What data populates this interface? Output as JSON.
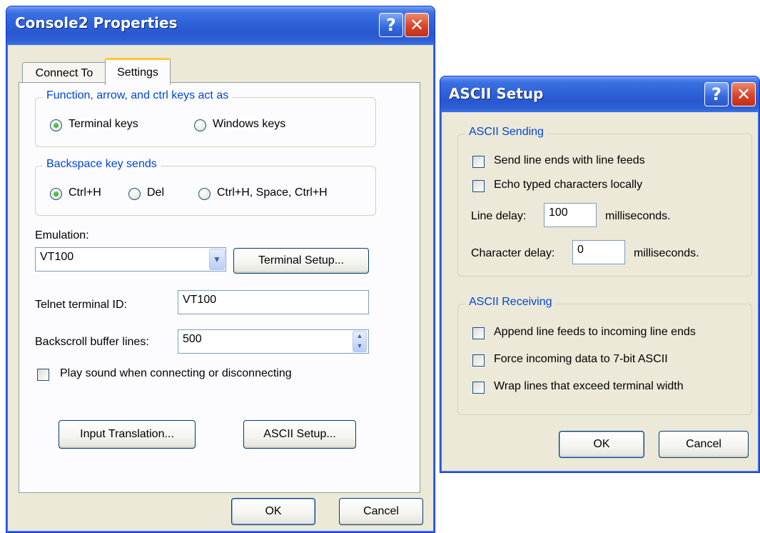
{
  "console_properties": {
    "title": "Console2 Properties",
    "help_glyph": "?",
    "close_glyph": "✕",
    "tabs": [
      {
        "label": "Connect To"
      },
      {
        "label": "Settings"
      }
    ],
    "function_keys": {
      "legend": "Function, arrow, and ctrl keys act as",
      "options": [
        {
          "label": "Terminal keys",
          "checked": true
        },
        {
          "label": "Windows keys",
          "checked": false
        }
      ]
    },
    "backspace": {
      "legend": "Backspace key sends",
      "options": [
        {
          "label": "Ctrl+H",
          "checked": true
        },
        {
          "label": "Del",
          "checked": false
        },
        {
          "label": "Ctrl+H, Space, Ctrl+H",
          "checked": false
        }
      ]
    },
    "emulation": {
      "label": "Emulation:",
      "value": "VT100",
      "terminal_setup_label": "Terminal Setup..."
    },
    "telnet": {
      "label": "Telnet terminal ID:",
      "value": "VT100"
    },
    "backscroll": {
      "label": "Backscroll buffer lines:",
      "value": "500"
    },
    "play_sound": {
      "label": "Play sound when connecting or disconnecting",
      "checked": false
    },
    "input_translation_label": "Input Translation...",
    "ascii_setup_label": "ASCII Setup...",
    "ok_label": "OK",
    "cancel_label": "Cancel"
  },
  "ascii_setup": {
    "title": "ASCII Setup",
    "help_glyph": "?",
    "close_glyph": "✕",
    "sending": {
      "legend": "ASCII Sending",
      "send_line_ends": "Send line ends with line feeds",
      "echo_typed": "Echo typed characters locally",
      "line_delay_label": "Line delay:",
      "line_delay_value": "100",
      "line_delay_unit": "milliseconds.",
      "char_delay_label": "Character delay:",
      "char_delay_value": "0",
      "char_delay_unit": "milliseconds."
    },
    "receiving": {
      "legend": "ASCII Receiving",
      "append_line_feeds": "Append line feeds to incoming line ends",
      "force_7bit": "Force incoming data to 7-bit ASCII",
      "wrap_lines": "Wrap lines that exceed terminal width"
    },
    "ok_label": "OK",
    "cancel_label": "Cancel"
  }
}
